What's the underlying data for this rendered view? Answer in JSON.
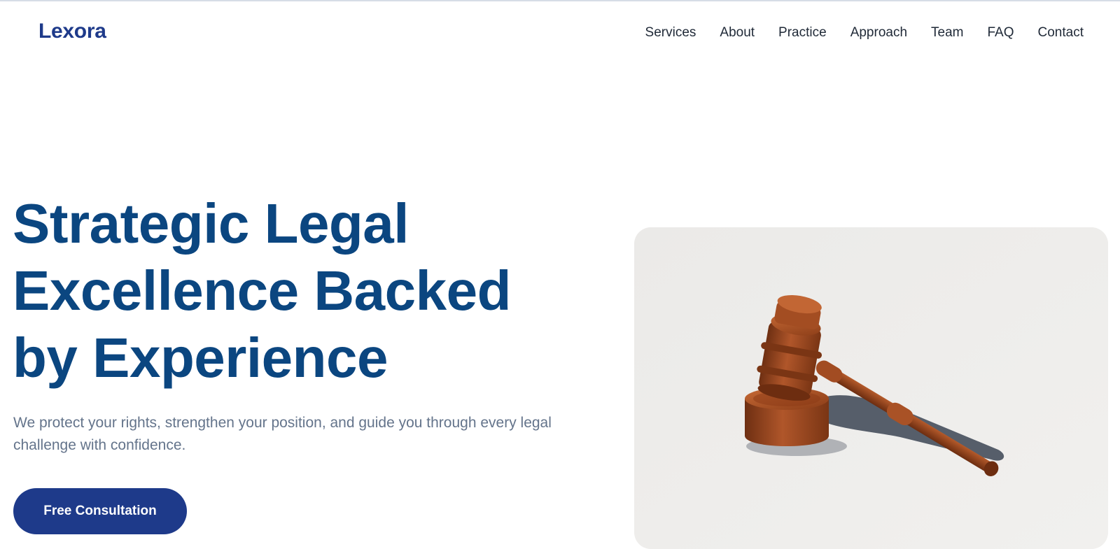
{
  "brand": {
    "name": "Lexora"
  },
  "nav": {
    "items": [
      {
        "label": "Services"
      },
      {
        "label": "About"
      },
      {
        "label": "Practice"
      },
      {
        "label": "Approach"
      },
      {
        "label": "Team"
      },
      {
        "label": "FAQ"
      },
      {
        "label": "Contact"
      }
    ]
  },
  "hero": {
    "title_lines": [
      "Strategic Legal",
      "Excellence Backed",
      "by Experience"
    ],
    "subtitle_lines": [
      "We protect your rights, strengthen your position, and guide you through every legal",
      "challenge with confidence."
    ],
    "cta_label": "Free Consultation"
  },
  "colors": {
    "brand": "#1e3a8a",
    "headline": "#0b4680",
    "body_text": "#64748b",
    "nav_text": "#1f2937"
  }
}
